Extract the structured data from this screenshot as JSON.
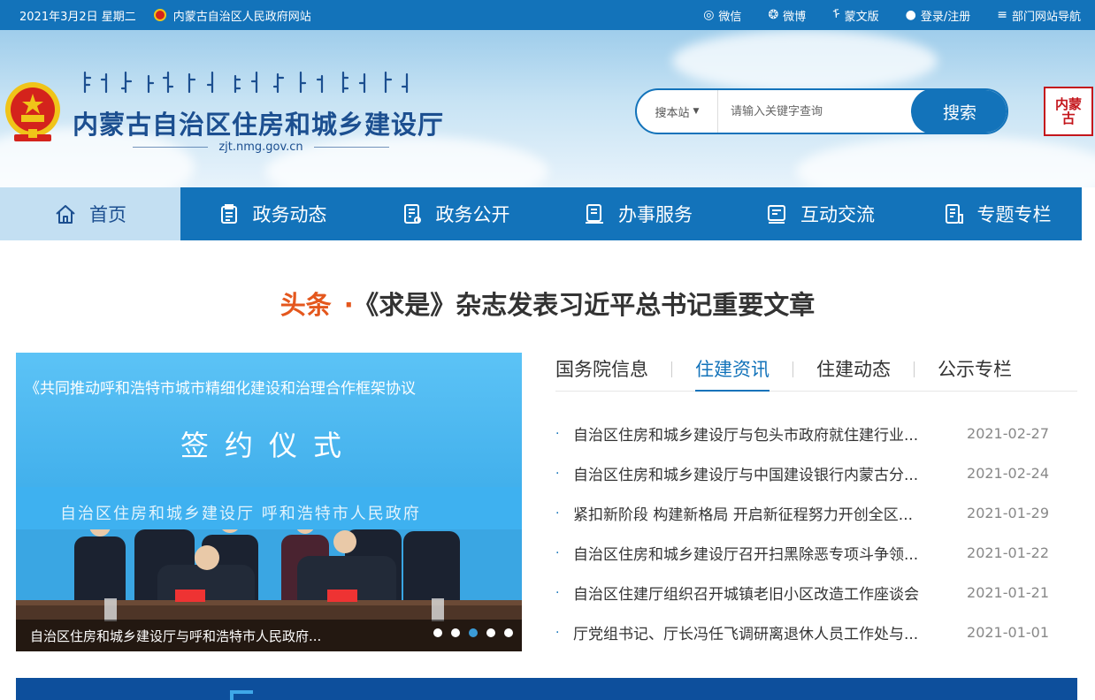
{
  "topbar": {
    "date": "2021年3月2日 星期二",
    "gov_link": "内蒙古自治区人民政府网站",
    "links": [
      {
        "icon": "weibo-icon",
        "label": "微信",
        "glyph": "◎"
      },
      {
        "icon": "wechat-icon",
        "label": "微博",
        "glyph": "❂"
      },
      {
        "icon": "mongolian-icon",
        "label": "蒙文版",
        "glyph": "ᠮ"
      },
      {
        "icon": "user-icon",
        "label": "登录/注册",
        "glyph": "●"
      },
      {
        "icon": "menu-icon",
        "label": "部门网站导航",
        "glyph": "≡"
      }
    ]
  },
  "header": {
    "title": "内蒙古自治区住房和城乡建设厅",
    "url": "zjt.nmg.gov.cn",
    "seal_text": "内蒙古"
  },
  "search": {
    "scope": "搜本站",
    "placeholder": "请输入关键字查询",
    "button": "搜索"
  },
  "nav": [
    {
      "name": "home",
      "label": "首页",
      "active": true
    },
    {
      "name": "news",
      "label": "政务动态",
      "active": false
    },
    {
      "name": "open",
      "label": "政务公开",
      "active": false
    },
    {
      "name": "service",
      "label": "办事服务",
      "active": false
    },
    {
      "name": "interact",
      "label": "互动交流",
      "active": false
    },
    {
      "name": "topics",
      "label": "专题专栏",
      "active": false
    }
  ],
  "headline": {
    "tag": "头条",
    "dot": "·",
    "text": "《求是》杂志发表习近平总书记重要文章"
  },
  "slider": {
    "banner_title": "《共同推动呼和浩特市城市精细化建设和治理合作框架协议",
    "ceremony": "签约仪式",
    "subtitle": "自治区住房和城乡建设厅  呼和浩特市人民政府",
    "caption": "自治区住房和城乡建设厅与呼和浩特市人民政府...",
    "dot_count": 5,
    "active_dot": 2
  },
  "tabs": [
    {
      "label": "国务院信息",
      "active": false
    },
    {
      "label": "住建资讯",
      "active": true
    },
    {
      "label": "住建动态",
      "active": false
    },
    {
      "label": "公示专栏",
      "active": false
    }
  ],
  "news": [
    {
      "title": "自治区住房和城乡建设厅与包头市政府就住建行业...",
      "date": "2021-02-27"
    },
    {
      "title": "自治区住房和城乡建设厅与中国建设银行内蒙古分...",
      "date": "2021-02-24"
    },
    {
      "title": "紧扣新阶段 构建新格局 开启新征程努力开创全区...",
      "date": "2021-01-29"
    },
    {
      "title": "自治区住房和城乡建设厅召开扫黑除恶专项斗争领...",
      "date": "2021-01-22"
    },
    {
      "title": "自治区住建厅组织召开城镇老旧小区改造工作座谈会",
      "date": "2021-01-21"
    },
    {
      "title": "厅党组书记、厅长冯任飞调研离退休人员工作处与...",
      "date": "2021-01-01"
    }
  ],
  "colors": {
    "primary": "#1373ba",
    "accent": "#e4571d",
    "title_blue": "#1c4f90"
  }
}
